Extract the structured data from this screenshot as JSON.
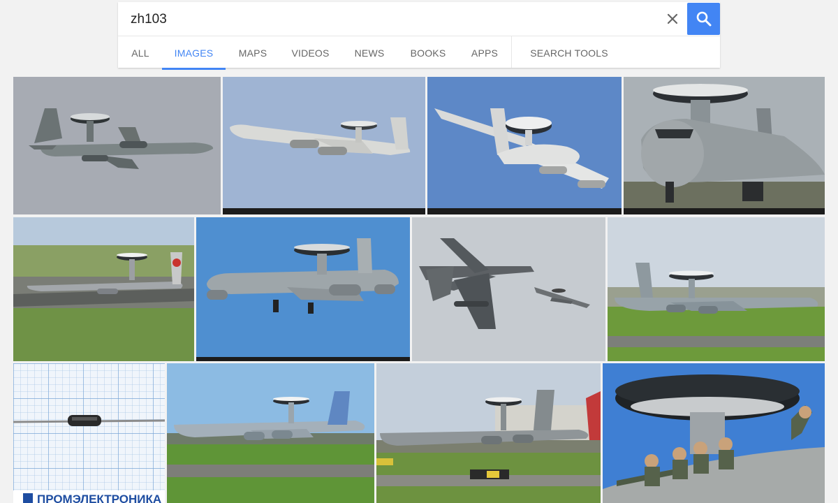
{
  "search": {
    "query": "zh103",
    "clear_icon": "close-icon",
    "search_icon": "search-icon",
    "accent_color": "#4285f4"
  },
  "tabs": [
    {
      "label": "ALL",
      "active": false
    },
    {
      "label": "IMAGES",
      "active": true
    },
    {
      "label": "MAPS",
      "active": false
    },
    {
      "label": "VIDEOS",
      "active": false
    },
    {
      "label": "NEWS",
      "active": false
    },
    {
      "label": "BOOKS",
      "active": false
    },
    {
      "label": "APPS",
      "active": false
    },
    {
      "label": "SEARCH TOOLS",
      "active": false
    }
  ],
  "results": {
    "thumbnails": [
      {
        "subject": "grey AWACS aircraft flying, side view"
      },
      {
        "subject": "AWACS aircraft taking off, blue sky"
      },
      {
        "subject": "AWACS aircraft banking, underside view"
      },
      {
        "subject": "AWACS aircraft parked, front view"
      },
      {
        "subject": "AWACS aircraft on runway, flight simulator"
      },
      {
        "subject": "AWACS aircraft flying, landing gear down"
      },
      {
        "subject": "Tornado jets with AWACS aircraft in distance"
      },
      {
        "subject": "AWACS aircraft on runway"
      },
      {
        "subject": "electronic component on graph paper",
        "caption": "ПРОМЭЛЕКТРОНИКА"
      },
      {
        "subject": "AWACS aircraft on runway, blue tail"
      },
      {
        "subject": "AWACS aircraft taxiing at airport"
      },
      {
        "subject": "crew sitting under radar rotodome"
      }
    ]
  }
}
